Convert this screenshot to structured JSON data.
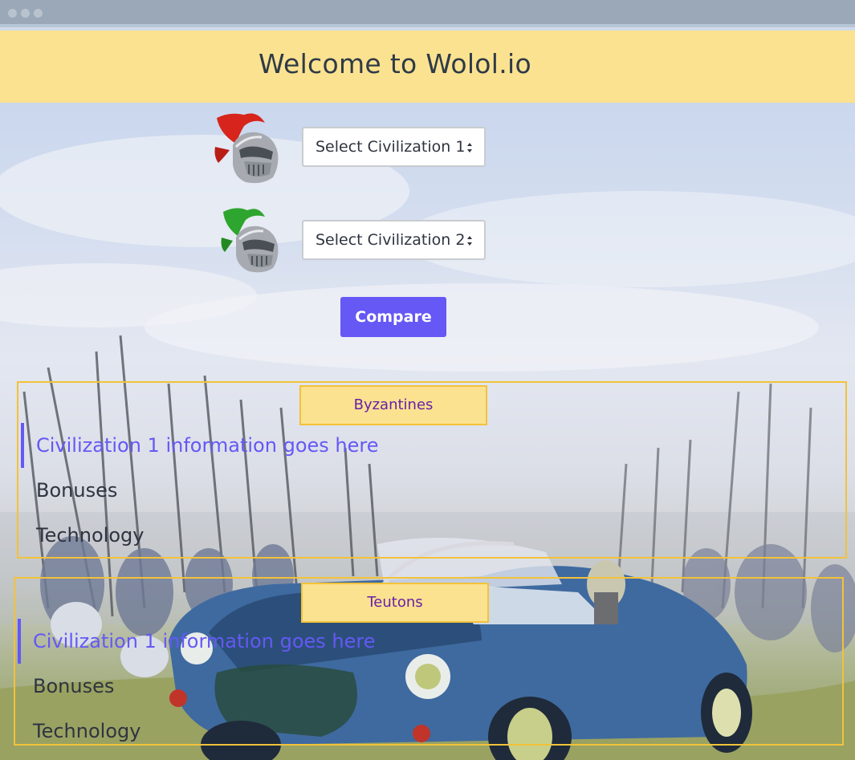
{
  "header": {
    "title": "Welcome to Wolol.io"
  },
  "selectors": {
    "civ1": {
      "value": "Select Civilization 1",
      "icon": "red-plumed-helmet-icon"
    },
    "civ2": {
      "value": "Select Civilization 2",
      "icon": "green-plumed-helmet-icon"
    }
  },
  "compare_button": {
    "label": "Compare"
  },
  "results": [
    {
      "civ_name": "Byzantines",
      "info": "Civilization 1 information goes here",
      "bonuses": "Bonuses",
      "technology": "Technology"
    },
    {
      "civ_name": "Teutons",
      "info": "Civilization 1 information goes here",
      "bonuses": "Bonuses",
      "technology": "Technology"
    }
  ],
  "colors": {
    "header_bg": "#fbe290",
    "accent": "#6558f5",
    "panel_border": "#f2c23a",
    "civ_text": "#6a1fa8"
  }
}
